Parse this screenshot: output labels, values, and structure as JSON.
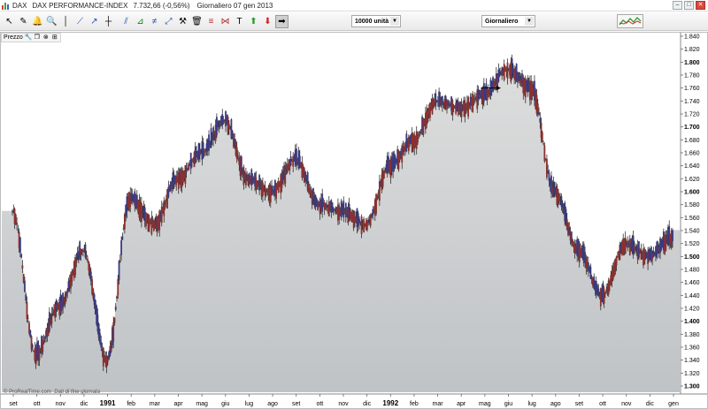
{
  "window": {
    "symbol": "DAX",
    "name": "DAX PERFORMANCE-INDEX",
    "quote": "7.732,66 (-0,56%)",
    "period_date": "Giornaliero  07 gen 2013"
  },
  "toolbar": {
    "units_value": "10000 unità",
    "timeframe_value": "Giornaliero"
  },
  "panel": {
    "label": "Prezzo"
  },
  "footer": {
    "source": "© ProRealTime.com",
    "note": "Dati di fine giornata"
  },
  "colors": {
    "area_fill": "#c8c8c8",
    "up_candle": "#3a3a80",
    "down_candle": "#8a3030",
    "wick": "#1a1a1a"
  },
  "chart_data": {
    "type": "candlestick",
    "interval": "daily",
    "x_tick_labels": [
      "set",
      "ott",
      "nov",
      "dic",
      "1991",
      "feb",
      "mar",
      "apr",
      "mag",
      "giu",
      "lug",
      "ago",
      "set",
      "ott",
      "nov",
      "dic",
      "1992",
      "feb",
      "mar",
      "apr",
      "mag",
      "giu",
      "lug",
      "ago",
      "set",
      "ott",
      "nov",
      "dic",
      "gen"
    ],
    "y_tick_labels": [
      "1.840",
      "1.820",
      "1.800",
      "1.780",
      "1.760",
      "1.740",
      "1.720",
      "1.700",
      "1.680",
      "1.660",
      "1.640",
      "1.620",
      "1.600",
      "1.580",
      "1.560",
      "1.540",
      "1.520",
      "1.500",
      "1.480",
      "1.460",
      "1.440",
      "1.420",
      "1.400",
      "1.380",
      "1.360",
      "1.340",
      "1.320",
      "1.300"
    ],
    "y_bold_labels": [
      "1.800",
      "1.700",
      "1.600",
      "1.500",
      "1.400",
      "1.300"
    ],
    "ylim": [
      1290,
      1845
    ],
    "x": [
      "set",
      "ott",
      "nov",
      "dic",
      "1991",
      "feb",
      "mar",
      "apr",
      "mag",
      "giu",
      "lug",
      "ago",
      "set",
      "ott",
      "nov",
      "dic",
      "1992",
      "feb",
      "mar",
      "apr",
      "mag",
      "giu",
      "lug",
      "ago",
      "set",
      "ott",
      "nov",
      "dic",
      "gen"
    ],
    "close": [
      1570,
      1350,
      1425,
      1510,
      1340,
      1590,
      1550,
      1620,
      1660,
      1710,
      1620,
      1600,
      1650,
      1580,
      1570,
      1550,
      1640,
      1680,
      1740,
      1730,
      1750,
      1790,
      1760,
      1600,
      1510,
      1440,
      1520,
      1500,
      1530
    ],
    "annotation": "arrow pointing right near the 1992 high"
  }
}
